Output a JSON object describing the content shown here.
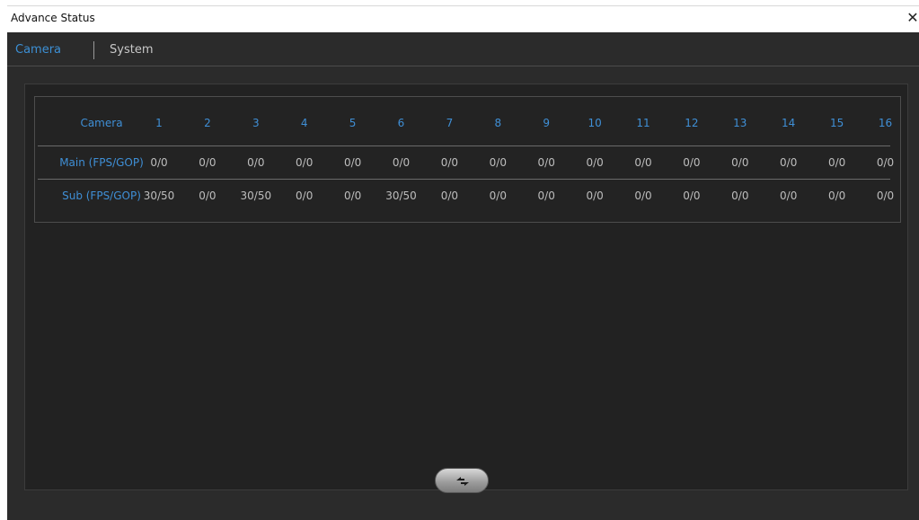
{
  "window": {
    "title": "Advance Status",
    "close_glyph": "✕"
  },
  "tabs": [
    {
      "label": "Camera",
      "active": true
    },
    {
      "label": "System",
      "active": false
    }
  ],
  "table": {
    "header_label": "Camera",
    "columns": [
      "1",
      "2",
      "3",
      "4",
      "5",
      "6",
      "7",
      "8",
      "9",
      "10",
      "11",
      "12",
      "13",
      "14",
      "15",
      "16"
    ],
    "rows": [
      {
        "label": "Main (FPS/GOP)",
        "values": [
          "0/0",
          "0/0",
          "0/0",
          "0/0",
          "0/0",
          "0/0",
          "0/0",
          "0/0",
          "0/0",
          "0/0",
          "0/0",
          "0/0",
          "0/0",
          "0/0",
          "0/0",
          "0/0"
        ]
      },
      {
        "label": "Sub (FPS/GOP)",
        "values": [
          "30/50",
          "0/0",
          "30/50",
          "0/0",
          "0/0",
          "30/50",
          "0/0",
          "0/0",
          "0/0",
          "0/0",
          "0/0",
          "0/0",
          "0/0",
          "0/0",
          "0/0",
          "0/0"
        ]
      }
    ]
  },
  "refresh_button": {
    "icon": "refresh-arrows-icon"
  },
  "colors": {
    "accent": "#3f8fd6",
    "panel_bg": "#2b2b2b",
    "content_bg": "#222222",
    "value_text": "#bdbdbd"
  }
}
